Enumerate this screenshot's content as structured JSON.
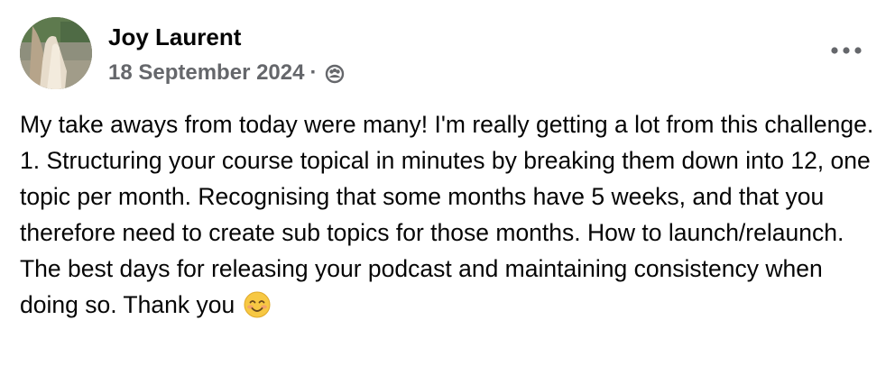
{
  "post": {
    "author": "Joy Laurent",
    "date": "18 September 2024",
    "separator": "·",
    "audience_icon": "audience-group-icon",
    "more_icon": "more-options-icon",
    "text": "My take aways from today were many! I'm really getting a lot from this challenge. 1. Structuring your course topical in minutes by breaking them down into 12, one topic per month. Recognising that some months have 5 weeks, and that you therefore need to create sub topics for those months. How to launch/relaunch. The best days for releasing your podcast and maintaining consistency when doing so. Thank you",
    "emoji": "smiling-face-emoji"
  },
  "colors": {
    "text": "#050505",
    "secondary_text": "#65676b",
    "background": "#ffffff"
  }
}
